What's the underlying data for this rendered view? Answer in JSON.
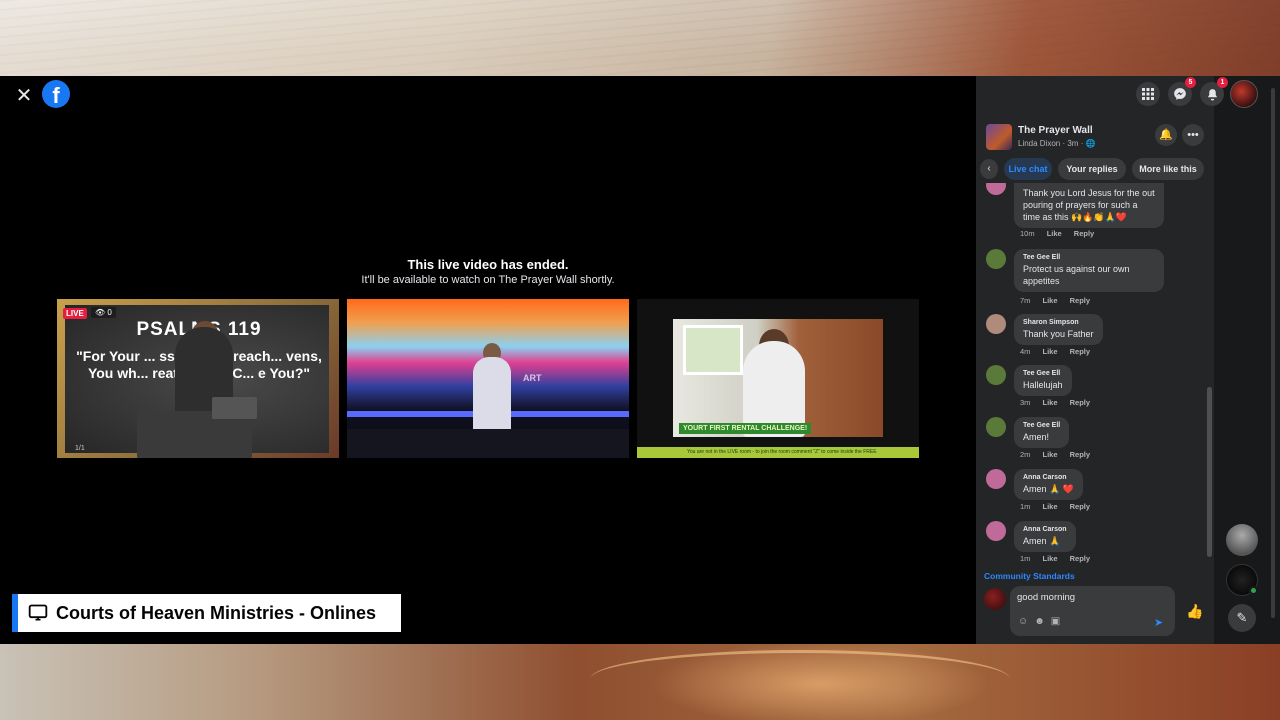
{
  "viewer": {
    "ended_title": "This live video has ended.",
    "ended_sub": "It'll be available to watch on The Prayer Wall shortly.",
    "close_glyph": "✕",
    "fb_glyph": "f"
  },
  "thumbs": [
    {
      "live": "LIVE",
      "viewers": "0",
      "heading": "PSALMS 119",
      "verse": "\"For Your ... ss, O God, reach... vens, You wh... reat things; C... e You?\"",
      "page": "1/1"
    },
    {
      "art": "ART"
    },
    {
      "banner": "YOURT FIRST RENTAL CHALLENGE!",
      "ticker": "You are not in the LIVE room - to join the room comment \"Z\" to come inside the FREE"
    }
  ],
  "channel": {
    "label": "Courts of Heaven Ministries - Onlines"
  },
  "topbar": {
    "messenger_badge": "5",
    "notifications_badge": "1"
  },
  "header": {
    "title": "The Prayer Wall",
    "subtitle": "Linda Dixon · 3m · 🌐"
  },
  "tabs": [
    {
      "label": "Live chat",
      "active": true
    },
    {
      "label": "Your replies",
      "active": false
    },
    {
      "label": "More like this",
      "active": false
    }
  ],
  "comments": [
    {
      "name": "",
      "text": "Thank you Lord Jesus for the out pouring of prayers for such a time as this 🙌🔥👏🙏❤️",
      "time": "10m",
      "avatar_color": "#c06a9a"
    },
    {
      "name": "Tee Gee Ell",
      "text": "Protect us against our own appetites",
      "time": "7m",
      "avatar_color": "#5a7a3a"
    },
    {
      "name": "Sharon Simpson",
      "text": "Thank you Father",
      "time": "4m",
      "avatar_color": "#b08a7a"
    },
    {
      "name": "Tee Gee Ell",
      "text": "Hallelujah",
      "time": "3m",
      "avatar_color": "#5a7a3a"
    },
    {
      "name": "Tee Gee Ell",
      "text": "Amen!",
      "time": "2m",
      "avatar_color": "#5a7a3a"
    },
    {
      "name": "Anna Carson",
      "text": "Amen 🙏 ❤️",
      "time": "1m",
      "avatar_color": "#c06a9a"
    },
    {
      "name": "Anna Carson",
      "text": "Amen 🙏",
      "time": "1m",
      "avatar_color": "#c06a9a"
    }
  ],
  "actions": {
    "like": "Like",
    "reply": "Reply"
  },
  "community_link": "Community Standards",
  "composer": {
    "value": "good morning"
  },
  "icons": {
    "close": "close-icon",
    "facebook": "facebook-logo-icon",
    "menu": "menu-grid-icon",
    "messenger": "messenger-icon",
    "notifications": "bell-icon",
    "monitor": "monitor-icon"
  }
}
